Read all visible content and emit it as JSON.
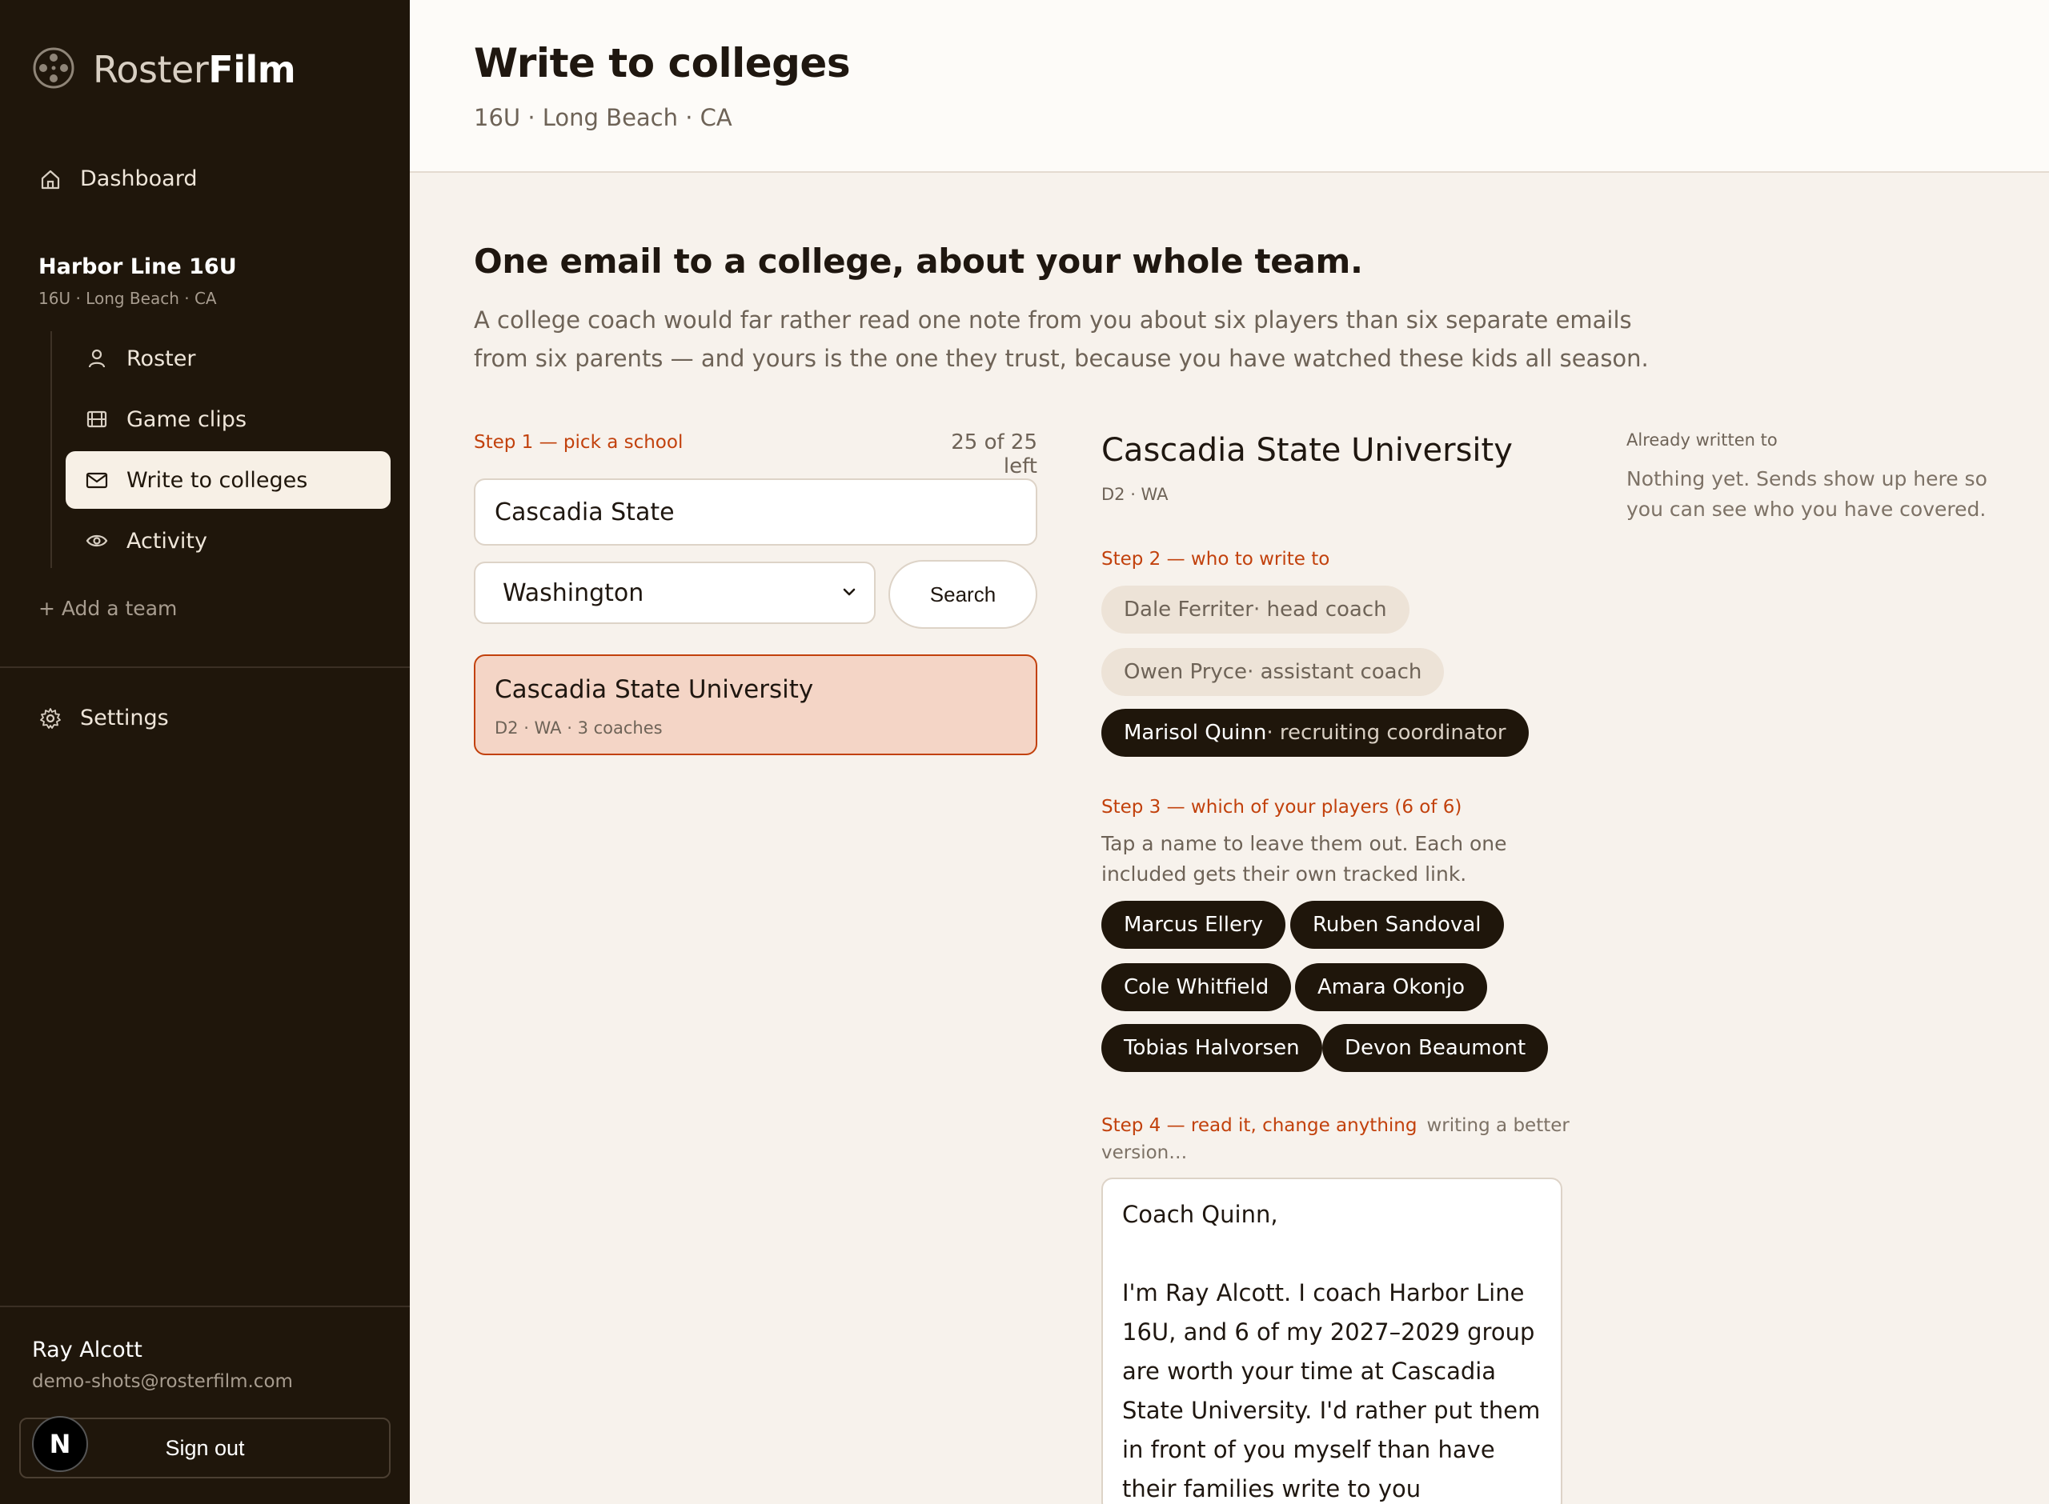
{
  "app": {
    "logo_light": "Roster",
    "logo_bold": "Film"
  },
  "sidebar": {
    "dashboard": "Dashboard",
    "team": {
      "name": "Harbor Line 16U",
      "sub": "16U · Long Beach · CA"
    },
    "team_nav": [
      {
        "label": "Roster",
        "icon": "person-icon"
      },
      {
        "label": "Game clips",
        "icon": "film-icon"
      },
      {
        "label": "Write to colleges",
        "icon": "mail-icon",
        "active": true
      },
      {
        "label": "Activity",
        "icon": "eye-icon"
      }
    ],
    "add_team": "+ Add a team",
    "settings": "Settings",
    "user": {
      "name": "Ray Alcott",
      "email": "demo-shots@rosterfilm.com"
    },
    "sign_out": "Sign out",
    "badge": "N"
  },
  "header": {
    "title": "Write to colleges",
    "subtitle": "16U · Long Beach · CA"
  },
  "hero": {
    "title": "One email to a college, about your whole team.",
    "description": "A college coach would far rather read one note from you about six players than six separate emails from six parents — and yours is the one they trust, because you have watched these kids all season."
  },
  "step1": {
    "label": "Step 1 — pick a school",
    "count": "25 of 25 left",
    "search_value": "Cascadia State",
    "state_value": "Washington",
    "search_button": "Search",
    "result": {
      "name": "Cascadia State University",
      "meta": "D2 · WA · 3 coaches"
    }
  },
  "school": {
    "name": "Cascadia State University",
    "meta": "D2 · WA"
  },
  "step2": {
    "label": "Step 2 — who to write to",
    "contacts": [
      {
        "name": "Dale Ferriter",
        "role": " · head coach",
        "selected": false
      },
      {
        "name": "Owen Pryce",
        "role": " · assistant coach",
        "selected": false
      },
      {
        "name": "Marisol Quinn",
        "role": " · recruiting coordinator",
        "selected": true
      }
    ]
  },
  "step3": {
    "label": "Step 3 — which of your players (6 of 6)",
    "help": "Tap a name to leave them out. Each one included gets their own tracked link.",
    "players": [
      "Marcus Ellery",
      "Ruben Sandoval",
      "Cole Whitfield",
      "Amara Okonjo",
      "Tobias Halvorsen",
      "Devon Beaumont"
    ]
  },
  "step4": {
    "label": "Step 4 — read it, change anything",
    "status": "writing a better version…",
    "email": {
      "greeting": "Coach Quinn,",
      "body": "I'm Ray Alcott. I coach Harbor Line 16U, and 6 of my 2027–2029 group are worth your time at Cascadia State University. I'd rather put them in front of you myself than have their families write to you separately."
    }
  },
  "already": {
    "label": "Already written to",
    "text": "Nothing yet. Sends show up here so you can see who you have covered."
  },
  "colors": {
    "accent": "#c2410c",
    "sidebar_bg": "#1f160b",
    "page_bg": "#f7f2ec",
    "selected_card": "#f4d5c6"
  }
}
